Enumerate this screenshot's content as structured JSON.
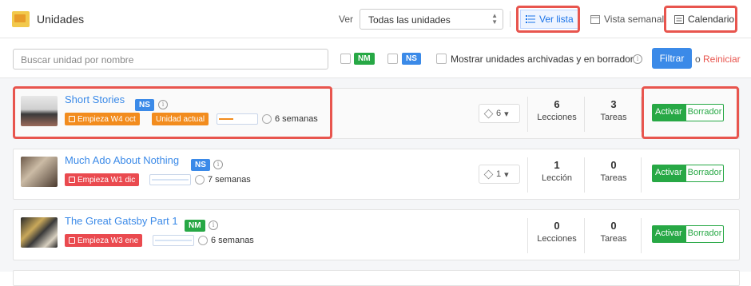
{
  "header": {
    "title": "Unidades",
    "ver_label": "Ver",
    "select_value": "Todas las unidades",
    "views": [
      "Ver lista",
      "Vista semanal",
      "Calendario"
    ]
  },
  "filters": {
    "search_placeholder": "Buscar unidad por nombre",
    "tag_nm": "NM",
    "tag_ns": "NS",
    "archived_label": "Mostrar unidades archivadas y en borrador",
    "filter_button": "Filtrar",
    "or_label": "o",
    "reset_link": "Reiniciar"
  },
  "units": [
    {
      "title": "Short Stories",
      "level": "NS",
      "start_chip": "Empieza W4 oct",
      "current_chip": "Unidad actual",
      "duration": "6 semanas",
      "progress": 0.4,
      "layers_count": "6",
      "lessons_count": "6",
      "lessons_label": "Lecciones",
      "tasks_count": "3",
      "tasks_label": "Tareas",
      "activate": "Activar",
      "draft": "Borrador"
    },
    {
      "title": "Much Ado About Nothing",
      "level": "NS",
      "start_chip": "Empieza W1 dic",
      "duration": "7 semanas",
      "progress": 0.0,
      "layers_count": "1",
      "lessons_count": "1",
      "lessons_label": "Lección",
      "tasks_count": "0",
      "tasks_label": "Tareas",
      "activate": "Activar",
      "draft": "Borrador"
    },
    {
      "title": "The Great Gatsby Part 1",
      "level": "NM",
      "start_chip": "Empieza W3 ene",
      "duration": "6 semanas",
      "progress": 0.0,
      "lessons_count": "0",
      "lessons_label": "Lecciones",
      "tasks_count": "0",
      "tasks_label": "Tareas",
      "activate": "Activar",
      "draft": "Borrador"
    }
  ],
  "colors": {
    "accent": "#3b8ae8",
    "highlight": "#e8554e",
    "green": "#27a845",
    "orange": "#f28c1e",
    "red": "#ea4a4f"
  }
}
